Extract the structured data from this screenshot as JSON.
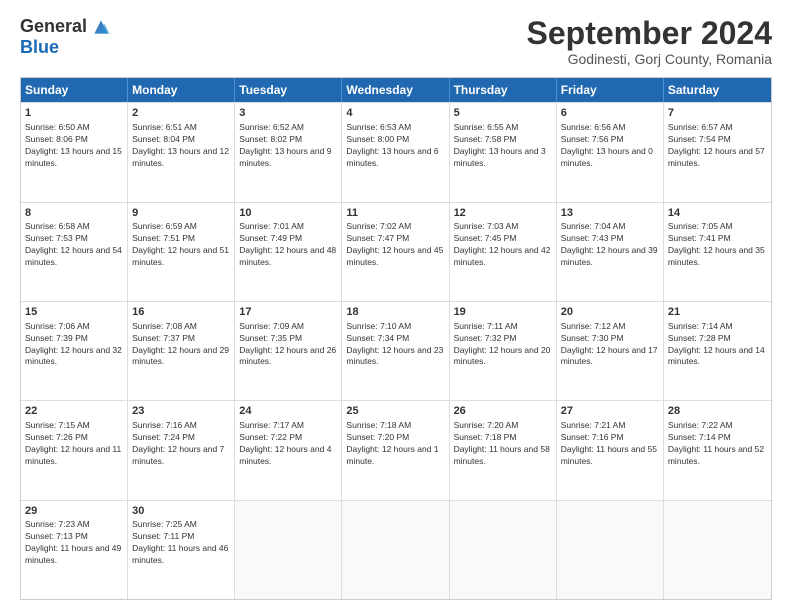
{
  "header": {
    "logo_general": "General",
    "logo_blue": "Blue",
    "month_title": "September 2024",
    "location": "Godinesti, Gorj County, Romania"
  },
  "calendar": {
    "days": [
      "Sunday",
      "Monday",
      "Tuesday",
      "Wednesday",
      "Thursday",
      "Friday",
      "Saturday"
    ],
    "weeks": [
      [
        {
          "day": "",
          "empty": true
        },
        {
          "day": "",
          "empty": true
        },
        {
          "day": "",
          "empty": true
        },
        {
          "day": "",
          "empty": true
        },
        {
          "day": "",
          "empty": true
        },
        {
          "day": "",
          "empty": true
        },
        {
          "day": "",
          "empty": true
        }
      ],
      [
        {
          "num": "1",
          "sunrise": "6:50 AM",
          "sunset": "8:06 PM",
          "daylight": "13 hours and 15 minutes."
        },
        {
          "num": "2",
          "sunrise": "6:51 AM",
          "sunset": "8:04 PM",
          "daylight": "13 hours and 12 minutes."
        },
        {
          "num": "3",
          "sunrise": "6:52 AM",
          "sunset": "8:02 PM",
          "daylight": "13 hours and 9 minutes."
        },
        {
          "num": "4",
          "sunrise": "6:53 AM",
          "sunset": "8:00 PM",
          "daylight": "13 hours and 6 minutes."
        },
        {
          "num": "5",
          "sunrise": "6:55 AM",
          "sunset": "7:58 PM",
          "daylight": "13 hours and 3 minutes."
        },
        {
          "num": "6",
          "sunrise": "6:56 AM",
          "sunset": "7:56 PM",
          "daylight": "13 hours and 0 minutes."
        },
        {
          "num": "7",
          "sunrise": "6:57 AM",
          "sunset": "7:54 PM",
          "daylight": "12 hours and 57 minutes."
        }
      ],
      [
        {
          "num": "8",
          "sunrise": "6:58 AM",
          "sunset": "7:53 PM",
          "daylight": "12 hours and 54 minutes."
        },
        {
          "num": "9",
          "sunrise": "6:59 AM",
          "sunset": "7:51 PM",
          "daylight": "12 hours and 51 minutes."
        },
        {
          "num": "10",
          "sunrise": "7:01 AM",
          "sunset": "7:49 PM",
          "daylight": "12 hours and 48 minutes."
        },
        {
          "num": "11",
          "sunrise": "7:02 AM",
          "sunset": "7:47 PM",
          "daylight": "12 hours and 45 minutes."
        },
        {
          "num": "12",
          "sunrise": "7:03 AM",
          "sunset": "7:45 PM",
          "daylight": "12 hours and 42 minutes."
        },
        {
          "num": "13",
          "sunrise": "7:04 AM",
          "sunset": "7:43 PM",
          "daylight": "12 hours and 39 minutes."
        },
        {
          "num": "14",
          "sunrise": "7:05 AM",
          "sunset": "7:41 PM",
          "daylight": "12 hours and 35 minutes."
        }
      ],
      [
        {
          "num": "15",
          "sunrise": "7:06 AM",
          "sunset": "7:39 PM",
          "daylight": "12 hours and 32 minutes."
        },
        {
          "num": "16",
          "sunrise": "7:08 AM",
          "sunset": "7:37 PM",
          "daylight": "12 hours and 29 minutes."
        },
        {
          "num": "17",
          "sunrise": "7:09 AM",
          "sunset": "7:35 PM",
          "daylight": "12 hours and 26 minutes."
        },
        {
          "num": "18",
          "sunrise": "7:10 AM",
          "sunset": "7:34 PM",
          "daylight": "12 hours and 23 minutes."
        },
        {
          "num": "19",
          "sunrise": "7:11 AM",
          "sunset": "7:32 PM",
          "daylight": "12 hours and 20 minutes."
        },
        {
          "num": "20",
          "sunrise": "7:12 AM",
          "sunset": "7:30 PM",
          "daylight": "12 hours and 17 minutes."
        },
        {
          "num": "21",
          "sunrise": "7:14 AM",
          "sunset": "7:28 PM",
          "daylight": "12 hours and 14 minutes."
        }
      ],
      [
        {
          "num": "22",
          "sunrise": "7:15 AM",
          "sunset": "7:26 PM",
          "daylight": "12 hours and 11 minutes."
        },
        {
          "num": "23",
          "sunrise": "7:16 AM",
          "sunset": "7:24 PM",
          "daylight": "12 hours and 7 minutes."
        },
        {
          "num": "24",
          "sunrise": "7:17 AM",
          "sunset": "7:22 PM",
          "daylight": "12 hours and 4 minutes."
        },
        {
          "num": "25",
          "sunrise": "7:18 AM",
          "sunset": "7:20 PM",
          "daylight": "12 hours and 1 minute."
        },
        {
          "num": "26",
          "sunrise": "7:20 AM",
          "sunset": "7:18 PM",
          "daylight": "11 hours and 58 minutes."
        },
        {
          "num": "27",
          "sunrise": "7:21 AM",
          "sunset": "7:16 PM",
          "daylight": "11 hours and 55 minutes."
        },
        {
          "num": "28",
          "sunrise": "7:22 AM",
          "sunset": "7:14 PM",
          "daylight": "11 hours and 52 minutes."
        }
      ],
      [
        {
          "num": "29",
          "sunrise": "7:23 AM",
          "sunset": "7:13 PM",
          "daylight": "11 hours and 49 minutes."
        },
        {
          "num": "30",
          "sunrise": "7:25 AM",
          "sunset": "7:11 PM",
          "daylight": "11 hours and 46 minutes."
        },
        {
          "day": "",
          "empty": true
        },
        {
          "day": "",
          "empty": true
        },
        {
          "day": "",
          "empty": true
        },
        {
          "day": "",
          "empty": true
        },
        {
          "day": "",
          "empty": true
        }
      ]
    ]
  }
}
